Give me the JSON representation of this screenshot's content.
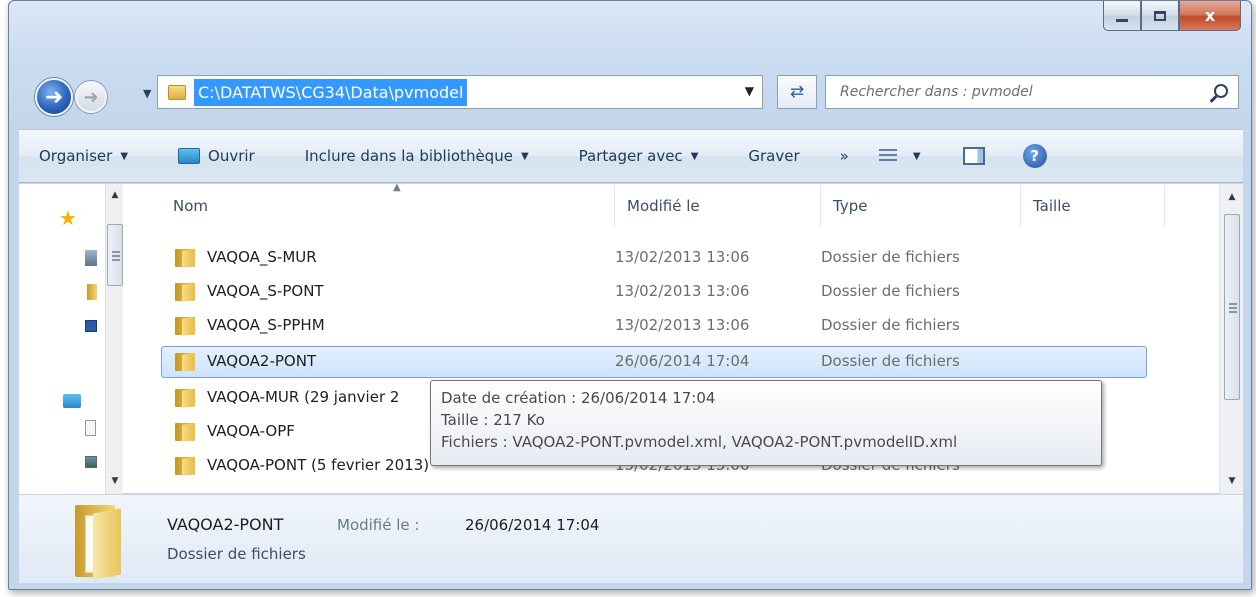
{
  "window": {
    "caption_buttons": {
      "minimize": "—",
      "maximize": "□",
      "close": "x"
    }
  },
  "navigation": {
    "address": "C:\\DATATWS\\CG34\\Data\\pvmodel",
    "search_placeholder": "Rechercher dans : pvmodel",
    "icons": [
      "back-arrow-icon",
      "forward-arrow-icon",
      "refresh-icon",
      "search-icon"
    ]
  },
  "toolbar": {
    "organise": "Organiser",
    "open": "Ouvrir",
    "include_library": "Inclure dans la bibliothèque",
    "share_with": "Partager avec",
    "burn": "Graver",
    "more": "»"
  },
  "columns": {
    "name": "Nom",
    "modified": "Modifié le",
    "type": "Type",
    "size": "Taille"
  },
  "files": [
    {
      "name": "VAQOA_S-MUR",
      "modified": "13/02/2013 13:06",
      "type": "Dossier de fichiers",
      "selected": false
    },
    {
      "name": "VAQOA_S-PONT",
      "modified": "13/02/2013 13:06",
      "type": "Dossier de fichiers",
      "selected": false
    },
    {
      "name": "VAQOA_S-PPHM",
      "modified": "13/02/2013 13:06",
      "type": "Dossier de fichiers",
      "selected": false
    },
    {
      "name": "VAQOA2-PONT",
      "modified": "26/06/2014 17:04",
      "type": "Dossier de fichiers",
      "selected": true
    },
    {
      "name": "VAQOA-MUR (29 janvier 2",
      "modified": "",
      "type": "",
      "selected": false
    },
    {
      "name": "VAQOA-OPF",
      "modified": "",
      "type": "",
      "selected": false
    },
    {
      "name": "VAQOA-PONT (5 fevrier 2013)",
      "modified": "13/02/2013 13:06",
      "type": "Dossier de fichiers",
      "selected": false
    }
  ],
  "tooltip": {
    "created": "Date de création : 26/06/2014 17:04",
    "size": "Taille : 217 Ko",
    "files": "Fichiers : VAQOA2-PONT.pvmodel.xml, VAQOA2-PONT.pvmodelID.xml"
  },
  "details": {
    "name": "VAQOA2-PONT",
    "modified_label": "Modifié le :",
    "modified_value": "26/06/2014 17:04",
    "type": "Dossier de fichiers"
  },
  "colors": {
    "accent": "#3399ff",
    "selection": "#cde4fb",
    "chrome": "#c9dcf0"
  }
}
